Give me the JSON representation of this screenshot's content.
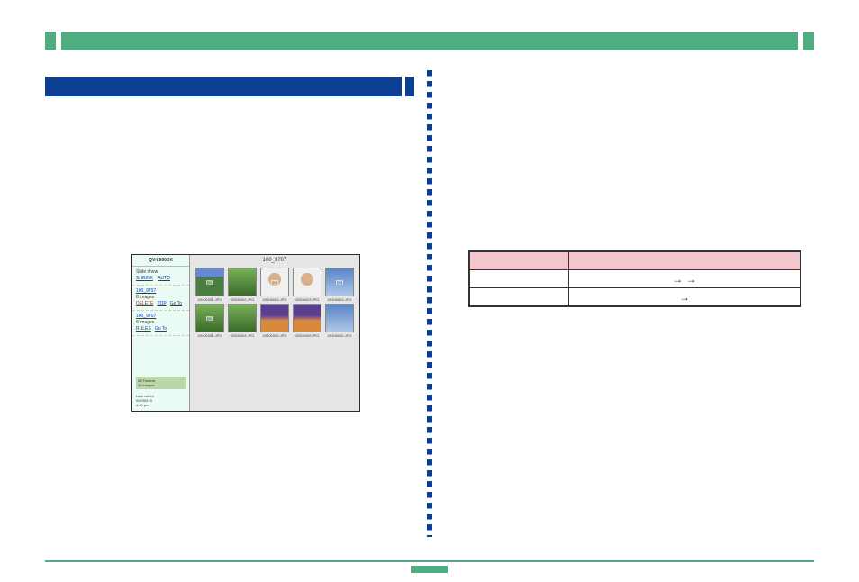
{
  "page_number": "",
  "screenshot": {
    "model": "QV-2900DX",
    "side": {
      "slide_show_label": "Slide show",
      "shrink_link": "SHRINK",
      "auto_link": "AUTO",
      "folder1": "100_9707",
      "folder1_note": "8 images",
      "del_link": "DELETE",
      "goto_link": "Go To",
      "top_link": "TOP",
      "folder2": "100_9707",
      "folder2_note": "8 images",
      "rules_link": "RULES"
    },
    "sel_box": {
      "title": "All Folders",
      "count": "16 images"
    },
    "foot": {
      "line1": "Last edited",
      "line2": "09/09/019",
      "line3": "4:00 pm"
    },
    "main_title": "100_9707",
    "thumbs_row1": [
      {
        "label": "09300001.JPG",
        "cls": "img",
        "tag": "[M]"
      },
      {
        "label": "09300002.JPG",
        "cls": "plant",
        "tag": ""
      },
      {
        "label": "09308003.JPG",
        "cls": "face",
        "tag": "[M]"
      },
      {
        "label": "09308003.JPG",
        "cls": "face",
        "tag": ""
      },
      {
        "label": "09308003.JPG",
        "cls": "sky",
        "tag": "[M]"
      }
    ],
    "thumbs_row2": [
      {
        "label": "09300004.JPG",
        "cls": "plant",
        "tag": "[M]"
      },
      {
        "label": "09300004.JPG",
        "cls": "plant",
        "tag": ""
      },
      {
        "label": "09300005.JPG",
        "cls": "sunset",
        "tag": ""
      },
      {
        "label": "09300006.JPG",
        "cls": "sunset",
        "tag": ""
      },
      {
        "label": "09308006.JPG",
        "cls": "sky",
        "tag": ""
      }
    ]
  },
  "table": {
    "headers": [
      "",
      ""
    ],
    "rows": [
      [
        "",
        "→          →"
      ],
      [
        "",
        "→"
      ]
    ]
  }
}
